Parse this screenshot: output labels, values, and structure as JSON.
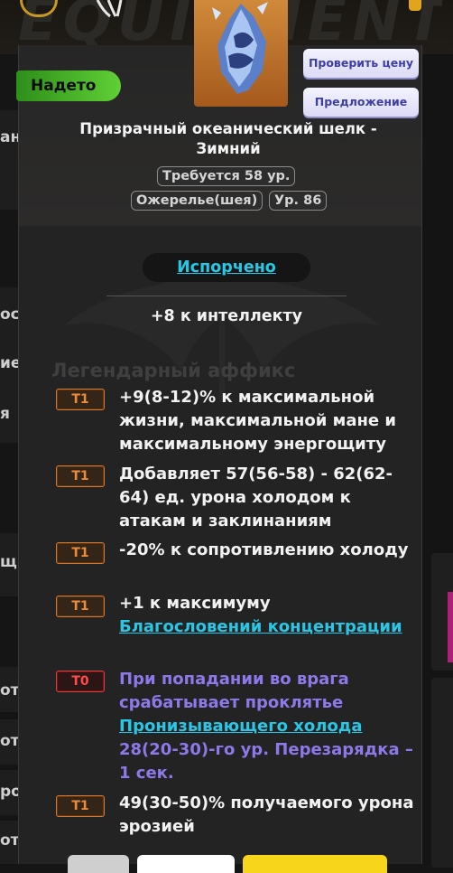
{
  "background": {
    "title": "EQUIPMENT",
    "left_labels": [
      "ан",
      "ост",
      "ие",
      "я",
      "щ",
      "от",
      "от",
      "рот",
      "от"
    ]
  },
  "item": {
    "equipped_label": "Надето",
    "check_price_label": "Проверить цену",
    "offer_label": "Предложение",
    "name": "Призрачный океанический шелк - Зимний",
    "requirement": "Требуется 58 ур.",
    "slot": "Ожерелье(шея)",
    "item_level": "Ур. 86",
    "corrupted_label": "Испорчено",
    "implicit": "+8 к интеллекту",
    "legendary_affix_header": "Легендарный аффикс"
  },
  "affixes": [
    {
      "tier": "T1",
      "text": "+9(8-12)% к максимальной жизни, максимальной мане и максимальному энергощиту"
    },
    {
      "tier": "T1",
      "text": "Добавляет 57(56-58) - 62(62-64) ед. урона холодом к атакам и заклинаниям"
    },
    {
      "tier": "T1",
      "text": "-20% к сопротивлению холоду"
    },
    {
      "tier": "T1",
      "text_before": "+1 к максимуму ",
      "link": "Благословений концентрации"
    },
    {
      "tier": "T0",
      "text_before": "При попадании во врага срабатывает проклятье ",
      "link": "Пронизывающего холода",
      "text_after": " 28(20-30)-го ур. Перезарядка – 1 сек."
    },
    {
      "tier": "T1",
      "text": "49(30-50)% получаемого урона эрозией"
    }
  ],
  "colors": {
    "equipped": "#4cbf2a",
    "tier_t1": "#ef8a39",
    "tier_t0": "#ff4b4b",
    "link": "#2ac6e6",
    "purple_affix": "#8e78ea"
  },
  "icons": {
    "item": "frost-necklace-icon",
    "watermark": "ornament-icon"
  }
}
